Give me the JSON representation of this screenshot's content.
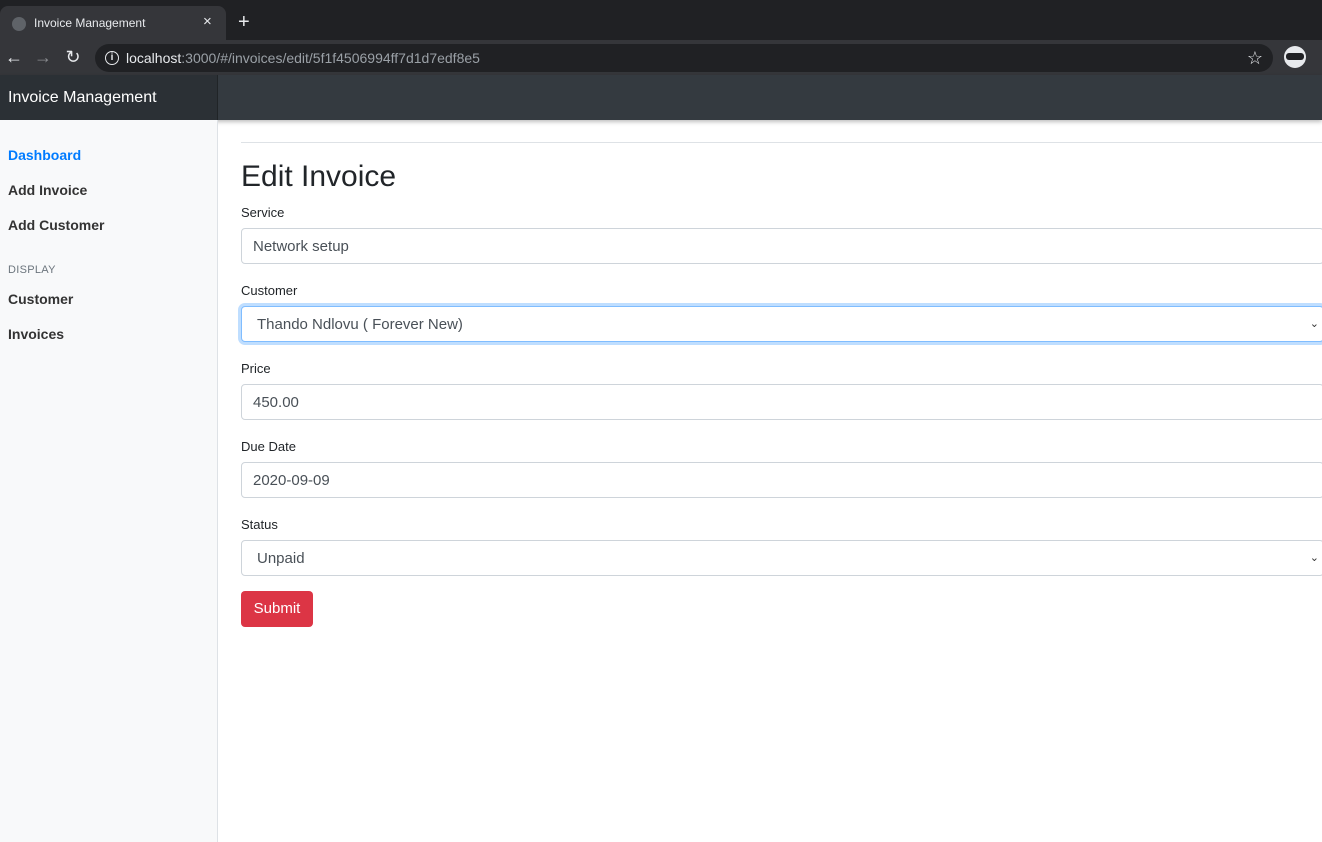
{
  "browser": {
    "tab_title": "Invoice Management",
    "tab_close": "×",
    "new_tab": "+",
    "url_host": "localhost",
    "url_rest": ":3000/#/invoices/edit/5f1f4506994ff7d1d7edf8e5",
    "back_icon": "←",
    "forward_icon": "→",
    "reload_icon": "↻",
    "star_icon": "☆",
    "info_icon": "i"
  },
  "navbar": {
    "brand": "Invoice Management"
  },
  "sidebar": {
    "items": [
      {
        "label": "Dashboard",
        "active": true
      },
      {
        "label": "Add Invoice"
      },
      {
        "label": "Add Customer"
      }
    ],
    "display_heading": "DISPLAY",
    "display_items": [
      {
        "label": "Customer"
      },
      {
        "label": "Invoices"
      }
    ]
  },
  "form": {
    "title": "Edit Invoice",
    "service": {
      "label": "Service",
      "value": "Network setup"
    },
    "customer": {
      "label": "Customer",
      "value": "Thando Ndlovu ( Forever New)"
    },
    "price": {
      "label": "Price",
      "value": "450.00"
    },
    "due_date": {
      "label": "Due Date",
      "value": "2020-09-09"
    },
    "status": {
      "label": "Status",
      "value": "Unpaid"
    },
    "submit_label": "Submit"
  },
  "colors": {
    "accent": "#007bff",
    "submit": "#dc3545",
    "navbar": "#343a40"
  }
}
